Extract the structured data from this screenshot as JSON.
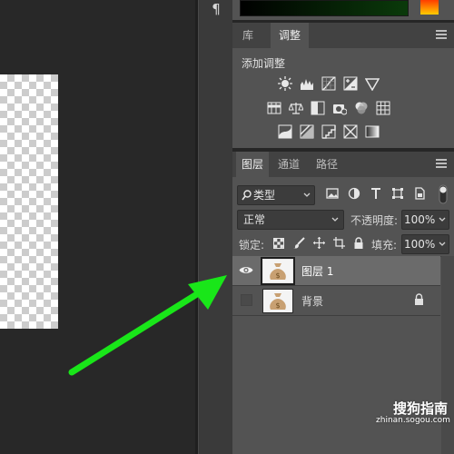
{
  "dock": {
    "paragraph_label": "¶"
  },
  "adjustments_panel": {
    "tabs": [
      {
        "label": "库"
      },
      {
        "label": "调整"
      }
    ],
    "title": "添加调整",
    "icons": [
      "brightness-contrast-icon",
      "levels-icon",
      "curves-icon",
      "exposure-icon",
      "vibrance-icon",
      "hue-saturation-icon",
      "color-balance-icon",
      "black-white-icon",
      "photo-filter-icon",
      "channel-mixer-icon",
      "color-lookup-icon",
      "invert-icon",
      "posterize-icon",
      "threshold-icon",
      "selective-color-icon",
      "gradient-map-icon"
    ]
  },
  "layers_panel": {
    "tabs": [
      {
        "label": "图层"
      },
      {
        "label": "通道"
      },
      {
        "label": "路径"
      }
    ],
    "filter": {
      "label": "类型"
    },
    "blend_mode": "正常",
    "opacity_label": "不透明度:",
    "opacity_value": "100%",
    "lock_label": "锁定:",
    "fill_label": "填充:",
    "fill_value": "100%",
    "layers": [
      {
        "name": "图层 1",
        "visible": true,
        "selected": true,
        "locked": false
      },
      {
        "name": "背景",
        "visible": false,
        "selected": false,
        "locked": true
      }
    ]
  },
  "watermark": {
    "text": "搜狗指南",
    "url": "zhinan.sogou.com"
  },
  "colors": {
    "accent_arrow": "#19e619",
    "panel_bg": "#535353",
    "selected_row": "#6b6b6b"
  }
}
